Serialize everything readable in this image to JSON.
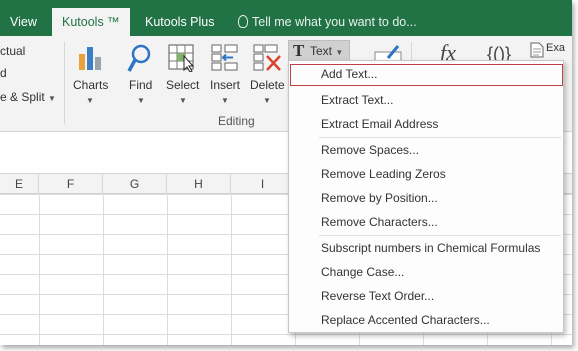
{
  "tabs": {
    "view": "View",
    "kutools": "Kutools ™",
    "kutools_plus": "Kutools Plus",
    "tell_me": "Tell me what you want to do..."
  },
  "ribbon": {
    "left_top": "ctual",
    "left_mid": "d",
    "left_split": "e & Split",
    "charts": "Charts",
    "find": "Find",
    "select": "Select",
    "insert": "Insert",
    "delete": "Delete",
    "text": "Text",
    "fx": "fx",
    "braces": "{()}",
    "right_top": "Exa",
    "group_editing": "Editing"
  },
  "columns": [
    "E",
    "F",
    "G",
    "H",
    "I"
  ],
  "menu": {
    "items": [
      "Add Text...",
      "Extract Text...",
      "Extract Email Address",
      "Remove Spaces...",
      "Remove Leading Zeros",
      "Remove by Position...",
      "Remove Characters...",
      "Subscript numbers in Chemical Formulas",
      "Change Case...",
      "Reverse Text Order...",
      "Replace Accented Characters..."
    ]
  },
  "colors": {
    "accent": "#217346",
    "highlight_border": "#c0404a"
  }
}
